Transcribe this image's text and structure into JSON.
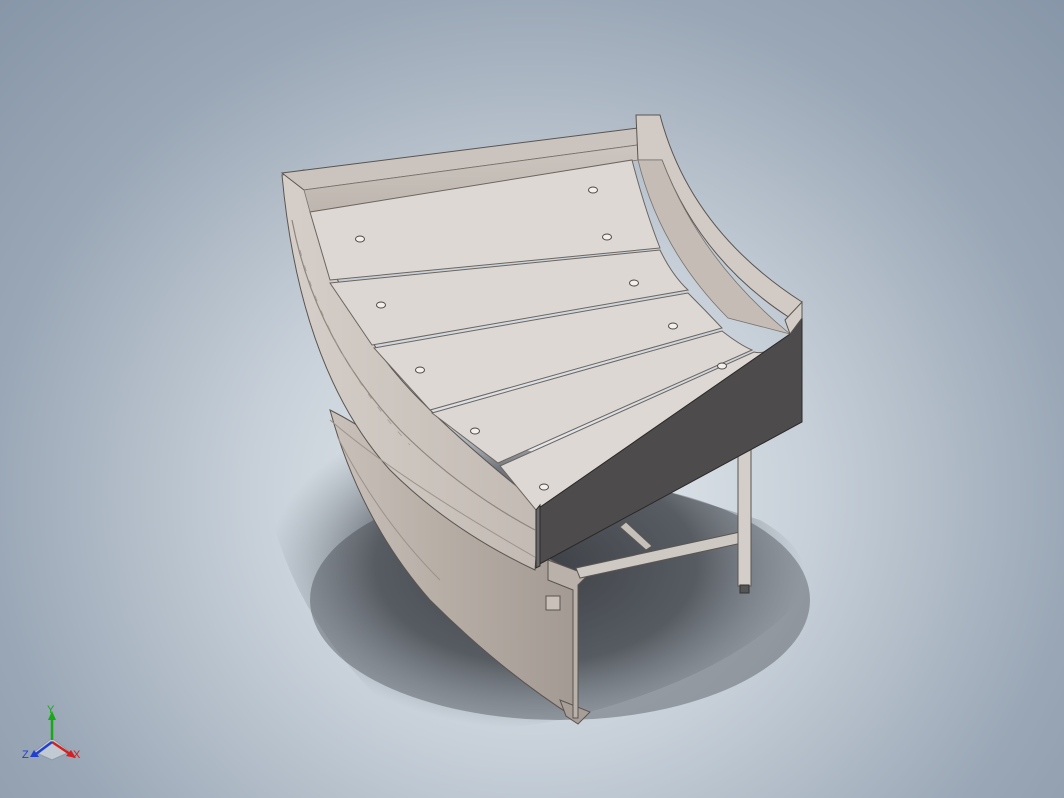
{
  "view": {
    "background_top": "#8796a8",
    "background_center": "#e9edf1",
    "model_color": "#d8d3cf",
    "model_dark_color": "#4a4848"
  },
  "triad": {
    "x_label": "X",
    "y_label": "Y",
    "z_label": "Z",
    "x_color": "#d42020",
    "y_color": "#18a818",
    "z_color": "#2040d0"
  }
}
